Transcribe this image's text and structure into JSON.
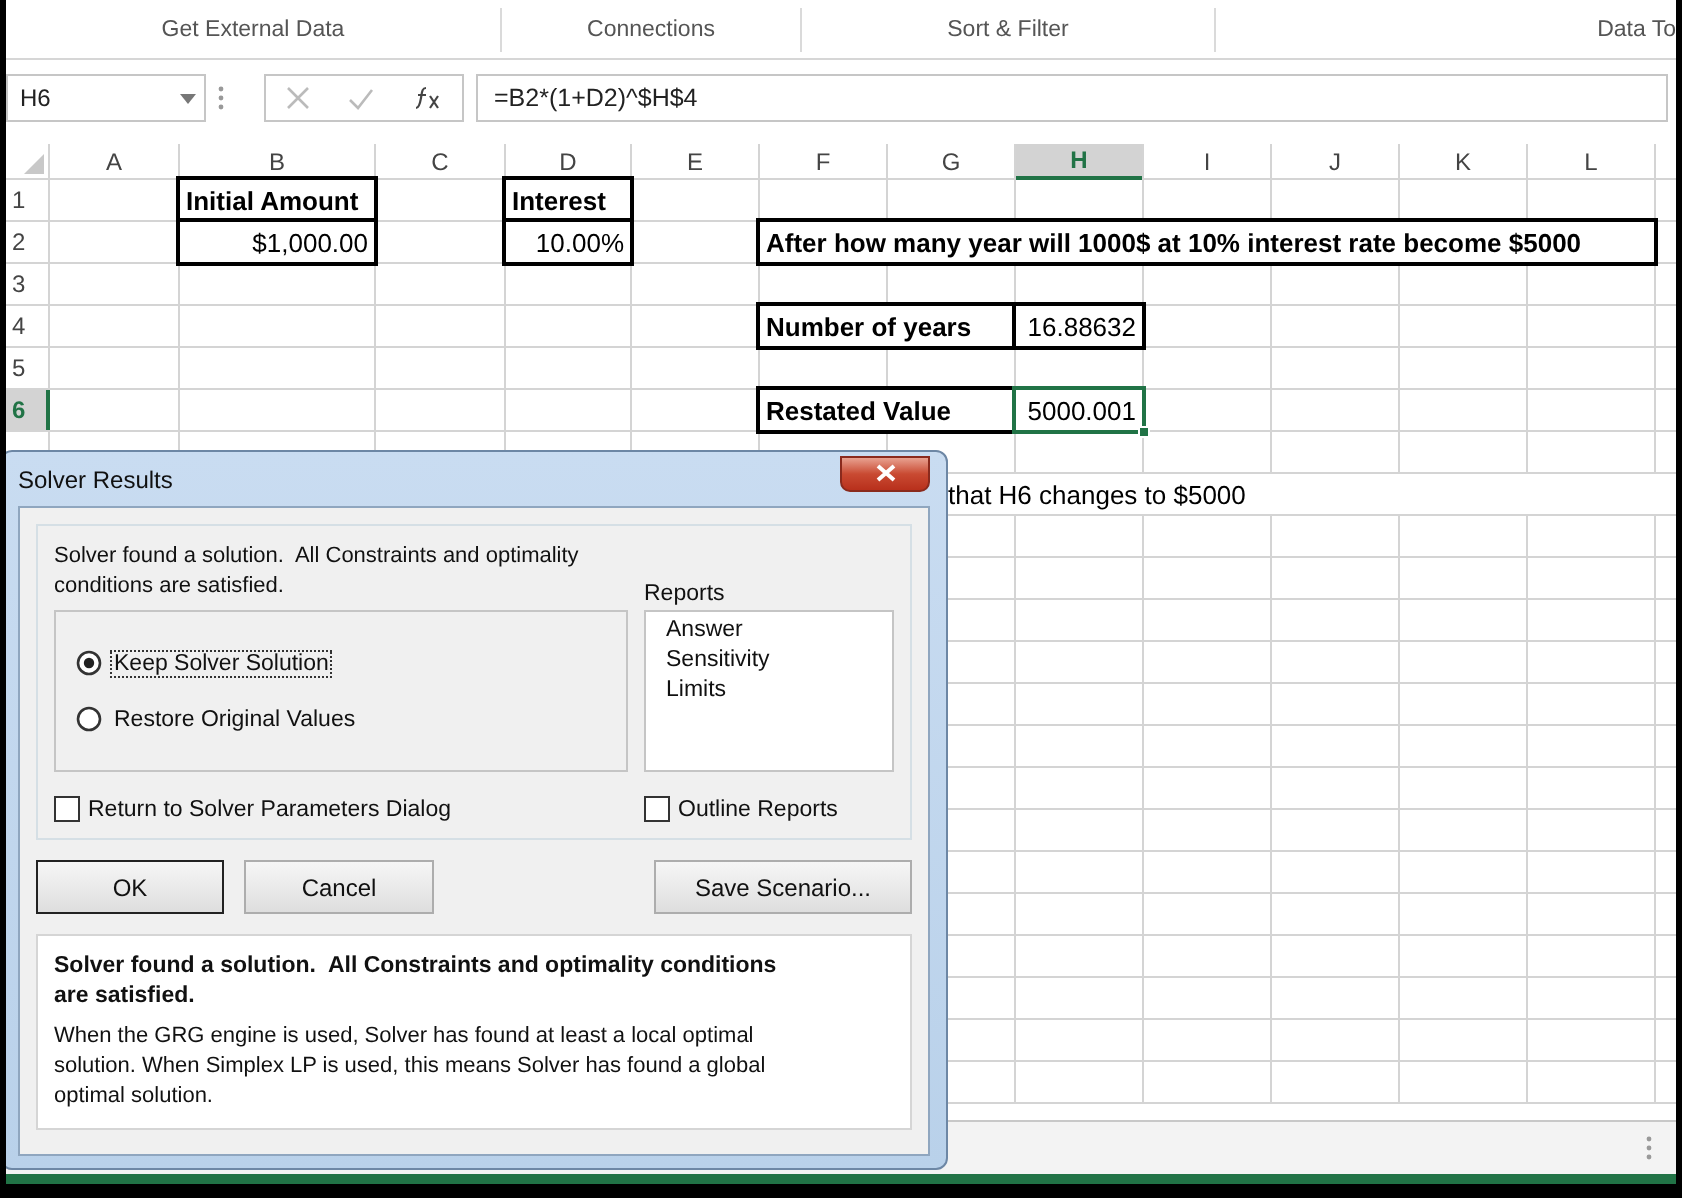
{
  "ribbon_groups": [
    {
      "label": "Get External Data"
    },
    {
      "label": "Connections"
    },
    {
      "label": "Sort & Filter"
    },
    {
      "label": "Data To"
    }
  ],
  "formula_bar": {
    "name_box": "H6",
    "formula": "=B2*(1+D2)^$H$4"
  },
  "columns": [
    {
      "label": "A",
      "selected": false
    },
    {
      "label": "B",
      "selected": false
    },
    {
      "label": "C",
      "selected": false
    },
    {
      "label": "D",
      "selected": false
    },
    {
      "label": "E",
      "selected": false
    },
    {
      "label": "F",
      "selected": false
    },
    {
      "label": "G",
      "selected": false
    },
    {
      "label": "H",
      "selected": true
    },
    {
      "label": "I",
      "selected": false
    },
    {
      "label": "J",
      "selected": false
    },
    {
      "label": "K",
      "selected": false
    },
    {
      "label": "L",
      "selected": false
    }
  ],
  "rows": [
    {
      "label": "1",
      "selected": false,
      "cells": [
        {
          "kind": "empty"
        },
        {
          "kind": "label",
          "text": "Initial Amount",
          "bold": true,
          "boxed": true,
          "selected": false
        },
        {
          "kind": "empty"
        },
        {
          "kind": "label",
          "text": "Interest",
          "bold": true,
          "boxed": true,
          "selected": false
        }
      ]
    },
    {
      "label": "2",
      "selected": false,
      "cells": [
        {
          "kind": "empty"
        },
        {
          "kind": "number",
          "text": "$1,000.00",
          "bold": false,
          "boxed": true,
          "selected": false
        },
        {
          "kind": "empty"
        },
        {
          "kind": "number",
          "text": "10.00%",
          "bold": false,
          "boxed": true,
          "selected": false
        },
        {
          "kind": "empty"
        },
        {
          "kind": "rest",
          "text": "After how many year will 1000$ at 10% interest rate become $5000",
          "bold": true,
          "boxed": true,
          "selected": false
        }
      ]
    },
    {
      "label": "3",
      "selected": false,
      "cells": []
    },
    {
      "label": "4",
      "selected": false,
      "cells": [
        {
          "kind": "empty"
        },
        {
          "kind": "empty"
        },
        {
          "kind": "empty"
        },
        {
          "kind": "empty"
        },
        {
          "kind": "empty"
        },
        {
          "kind": "pair",
          "text": "Number of years",
          "bold": true,
          "boxed": true,
          "selected": false
        },
        {
          "kind": "number",
          "text": "16.88632",
          "bold": false,
          "boxed": true,
          "selected": false
        }
      ]
    },
    {
      "label": "5",
      "selected": false,
      "cells": []
    },
    {
      "label": "6",
      "selected": true,
      "cells": [
        {
          "kind": "empty"
        },
        {
          "kind": "empty"
        },
        {
          "kind": "empty"
        },
        {
          "kind": "empty"
        },
        {
          "kind": "empty"
        },
        {
          "kind": "pair",
          "text": "Restated Value",
          "bold": true,
          "boxed": true,
          "selected": false
        },
        {
          "kind": "number",
          "text": "5000.001",
          "bold": false,
          "boxed": true,
          "selected": true
        }
      ]
    }
  ],
  "note": {
    "text": "that H6 changes to $5000"
  },
  "dialog": {
    "title": "Solver Results",
    "message": "Solver found a solution.  All Constraints and optimality conditions are satisfied.",
    "options": [
      {
        "label": "Keep Solver Solution",
        "selected": true,
        "focused": true
      },
      {
        "label": "Restore Original Values",
        "selected": false,
        "focused": false
      }
    ],
    "reports": {
      "label": "Reports",
      "items": [
        "Answer",
        "Sensitivity",
        "Limits"
      ]
    },
    "checkboxes": [
      {
        "label": "Return to Solver Parameters Dialog",
        "checked": false
      },
      {
        "label": "Outline Reports",
        "checked": false
      }
    ],
    "buttons": [
      {
        "label": "OK",
        "default": true
      },
      {
        "label": "Cancel",
        "default": false
      },
      {
        "label": "Save Scenario...",
        "default": false
      }
    ],
    "info": {
      "heading": "Solver found a solution.  All Constraints and optimality conditions are satisfied.",
      "body": "When the GRG engine is used, Solver has found at least a local optimal solution. When Simplex LP is used, this means Solver has found a global optimal solution."
    }
  }
}
